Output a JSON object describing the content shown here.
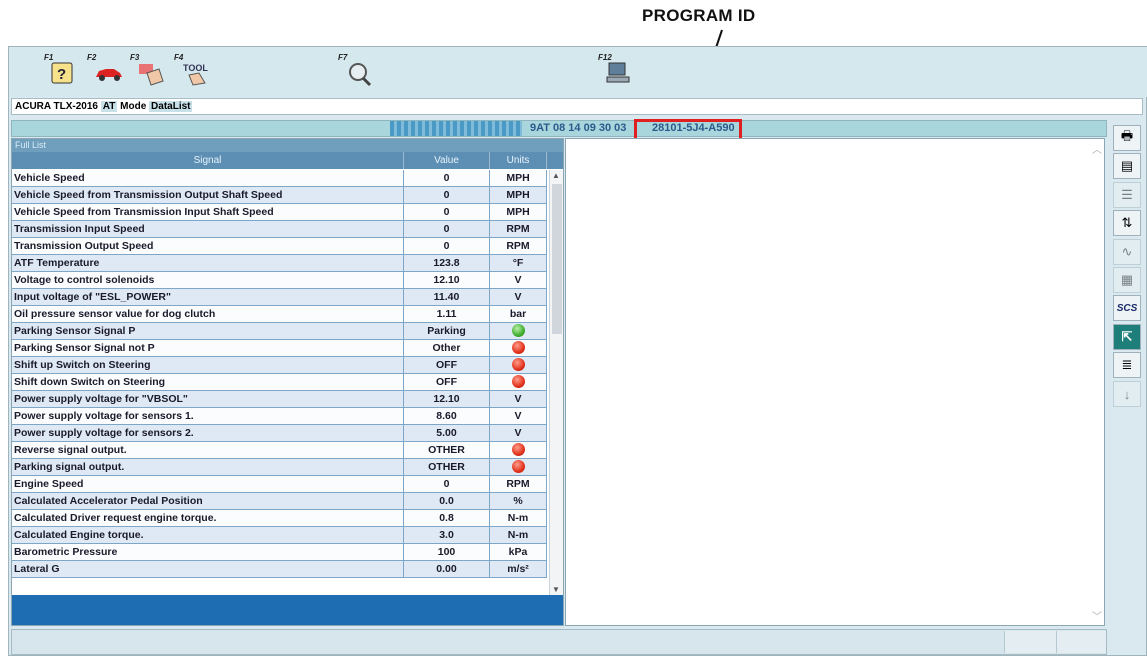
{
  "annotation": {
    "label": "PROGRAM ID"
  },
  "toolbar": {
    "keys": [
      {
        "label": "F1",
        "icon": "help-icon"
      },
      {
        "label": "F2",
        "icon": "car-icon"
      },
      {
        "label": "F3",
        "icon": "hand-select-icon"
      },
      {
        "label": "F4",
        "icon": "tool-icon",
        "text": "TOOL"
      },
      {
        "label": "F7",
        "icon": "magnifier-icon"
      },
      {
        "label": "F12",
        "icon": "computer-icon"
      }
    ]
  },
  "mode_bar": {
    "vehicle": "ACURA TLX-2016",
    "system": "AT",
    "mode_label": "Mode",
    "mode": "DataList"
  },
  "vin_bar": {
    "info": "9AT  08 14 09 30 03",
    "program_id": "28101-5J4-A590"
  },
  "list": {
    "title": "Full List",
    "headers": {
      "signal": "Signal",
      "value": "Value",
      "units": "Units"
    },
    "rows": [
      {
        "signal": "Vehicle Speed",
        "value": "0",
        "unit": "MPH"
      },
      {
        "signal": "Vehicle Speed from Transmission Output Shaft Speed",
        "value": "0",
        "unit": "MPH"
      },
      {
        "signal": "Vehicle Speed from Transmission Input Shaft Speed",
        "value": "0",
        "unit": "MPH"
      },
      {
        "signal": "Transmission Input Speed",
        "value": "0",
        "unit": "RPM"
      },
      {
        "signal": "Transmission Output Speed",
        "value": "0",
        "unit": "RPM"
      },
      {
        "signal": "ATF Temperature",
        "value": "123.8",
        "unit": "°F"
      },
      {
        "signal": "Voltage to control solenoids",
        "value": "12.10",
        "unit": "V"
      },
      {
        "signal": "Input voltage of  \"ESL_POWER\"",
        "value": "11.40",
        "unit": "V"
      },
      {
        "signal": "Oil pressure sensor value for dog clutch",
        "value": "1.11",
        "unit": "bar"
      },
      {
        "signal": "Parking Sensor Signal P",
        "value": "Parking",
        "unit": "",
        "indicator": "green"
      },
      {
        "signal": "Parking Sensor Signal not P",
        "value": "Other",
        "unit": "",
        "indicator": "red"
      },
      {
        "signal": "Shift up Switch on Steering",
        "value": "OFF",
        "unit": "",
        "indicator": "red"
      },
      {
        "signal": "Shift down Switch on Steering",
        "value": "OFF",
        "unit": "",
        "indicator": "red"
      },
      {
        "signal": "Power supply voltage for \"VBSOL\"",
        "value": "12.10",
        "unit": "V"
      },
      {
        "signal": "Power supply voltage for sensors 1.",
        "value": "8.60",
        "unit": "V"
      },
      {
        "signal": "Power supply voltage for sensors 2.",
        "value": "5.00",
        "unit": "V"
      },
      {
        "signal": "Reverse signal output.",
        "value": "OTHER",
        "unit": "",
        "indicator": "red"
      },
      {
        "signal": "Parking signal output.",
        "value": "OTHER",
        "unit": "",
        "indicator": "red"
      },
      {
        "signal": "Engine Speed",
        "value": "0",
        "unit": "RPM"
      },
      {
        "signal": "Calculated Accelerator Pedal Position",
        "value": "0.0",
        "unit": "%"
      },
      {
        "signal": "Calculated Driver request engine torque.",
        "value": "0.8",
        "unit": "N-m"
      },
      {
        "signal": "Calculated Engine torque.",
        "value": "3.0",
        "unit": "N-m"
      },
      {
        "signal": "Barometric Pressure",
        "value": "100",
        "unit": "kPa"
      },
      {
        "signal": "Lateral G",
        "value": "0.00",
        "unit": "m/s²"
      }
    ]
  },
  "side_buttons": [
    {
      "icon": "printer-icon",
      "enabled": true
    },
    {
      "icon": "select-signals-icon",
      "enabled": true
    },
    {
      "icon": "list-view-icon",
      "enabled": false
    },
    {
      "icon": "sort-icon",
      "enabled": true
    },
    {
      "icon": "graph-view-icon",
      "enabled": false
    },
    {
      "icon": "snapshot-icon",
      "enabled": false
    },
    {
      "icon": "scs-icon",
      "enabled": true,
      "text": "SCS"
    },
    {
      "icon": "exit-icon",
      "enabled": true
    },
    {
      "icon": "settings-list-icon",
      "enabled": true
    },
    {
      "icon": "download-icon",
      "enabled": false
    }
  ],
  "status_bar": {
    "icon": "wrench-check-icon"
  },
  "colors": {
    "toolbar": "#d5e8ee",
    "header": "#5d8fb5",
    "footer": "#1e6cb2",
    "highlight": "#e02020"
  }
}
